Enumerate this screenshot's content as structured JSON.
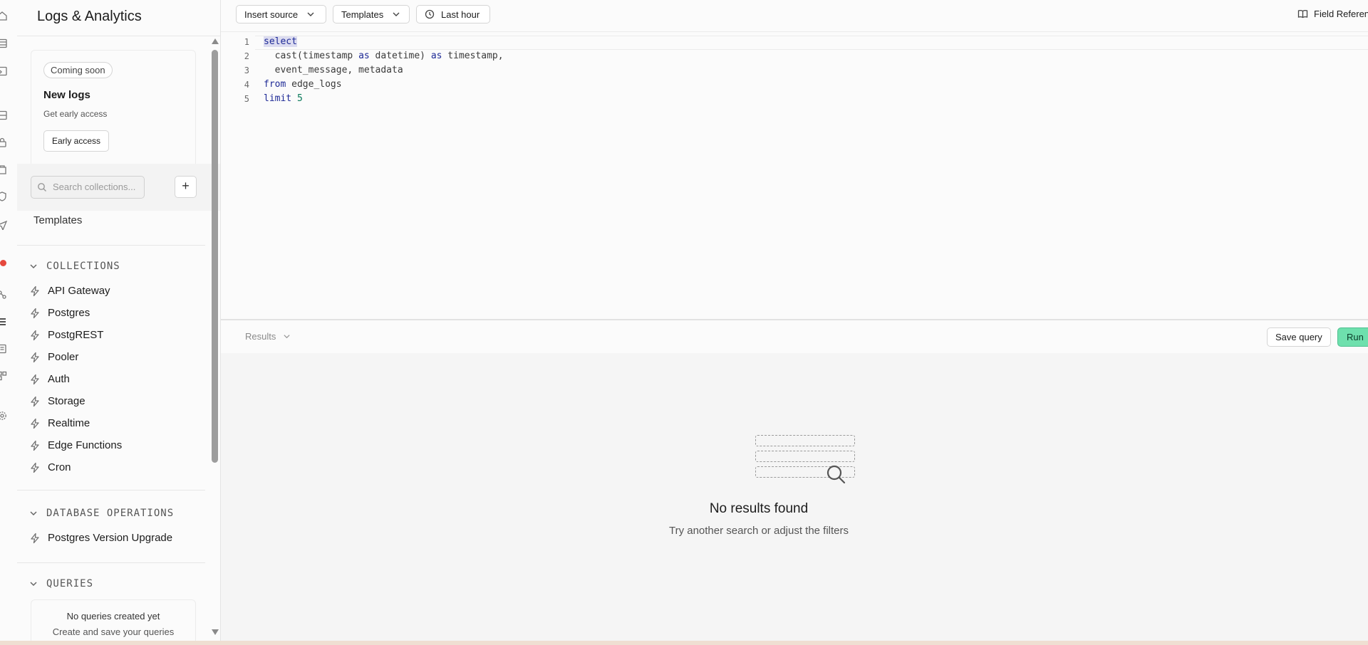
{
  "rail": {
    "icons": [
      "home-icon",
      "table-icon",
      "sql-editor-icon",
      "database-icon",
      "auth-icon",
      "storage-icon",
      "shield-icon",
      "send-icon",
      "api-icon",
      "logs-icon",
      "reports-icon",
      "integrations-icon",
      "settings-icon"
    ],
    "active": "logs-icon",
    "notification_color": "#e5483d"
  },
  "sidebar": {
    "title": "Logs & Analytics",
    "promo": {
      "badge": "Coming soon",
      "title": "New logs",
      "subtitle": "Get early access",
      "button": "Early access"
    },
    "search": {
      "placeholder": "Search collections...",
      "value": ""
    },
    "add_label": "+",
    "templates_link": "Templates",
    "collections": {
      "heading": "COLLECTIONS",
      "items": [
        "API Gateway",
        "Postgres",
        "PostgREST",
        "Pooler",
        "Auth",
        "Storage",
        "Realtime",
        "Edge Functions",
        "Cron"
      ]
    },
    "database_operations": {
      "heading": "DATABASE OPERATIONS",
      "items": [
        "Postgres Version Upgrade"
      ]
    },
    "queries": {
      "heading": "QUERIES",
      "empty_title": "No queries created yet",
      "empty_subtitle": "Create and save your queries"
    }
  },
  "toolbar": {
    "insert_source": "Insert source",
    "templates": "Templates",
    "time_range": "Last hour",
    "field_reference": "Field Reference"
  },
  "editor": {
    "line_numbers": [
      "1",
      "2",
      "3",
      "4",
      "5"
    ],
    "lines": [
      "select",
      "  cast(timestamp as datetime) as timestamp,",
      "  event_message, metadata",
      "from edge_logs",
      "limit 5"
    ]
  },
  "results": {
    "tab_label": "Results",
    "save_query": "Save query",
    "run": "Run",
    "empty_title": "No results found",
    "empty_subtitle": "Try another search or adjust the filters"
  },
  "colors": {
    "run_button": "#6ee0ad",
    "keyword": "#1e2a96",
    "number": "#0a7a5a"
  }
}
